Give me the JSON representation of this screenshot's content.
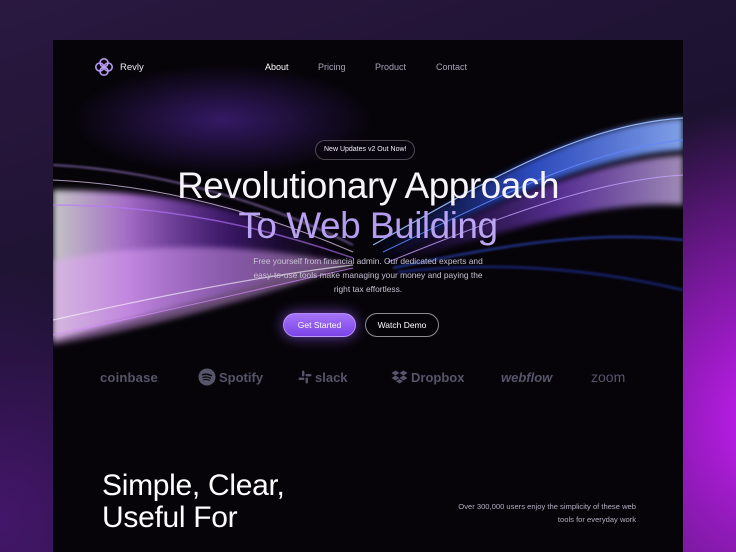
{
  "brand": {
    "name": "Revly"
  },
  "nav": {
    "items": [
      {
        "label": "About",
        "active": true
      },
      {
        "label": "Pricing",
        "active": false
      },
      {
        "label": "Product",
        "active": false
      },
      {
        "label": "Contact",
        "active": false
      }
    ]
  },
  "hero": {
    "badge": "New Updates v2 Out Now!",
    "title_line1": "Revolutionary Approach",
    "title_line2": "To Web Building",
    "subtitle": "Free yourself from financial admin. Our dedicated experts and easy-to-use tools make managing your money and paying the right tax effortless.",
    "primary_cta": "Get Started",
    "secondary_cta": "Watch Demo"
  },
  "logos": [
    "coinbase",
    "Spotify",
    "slack",
    "Dropbox",
    "webflow",
    "zoom"
  ],
  "section": {
    "title_line1": "Simple, Clear,",
    "title_line2": "Useful For",
    "note": "Over 300,000 users enjoy the simplicity of these web tools for everyday work"
  },
  "colors": {
    "accent": "#8a55ee",
    "background": "#060409",
    "glow": "#c21df0",
    "logo_gray": "#57556a"
  },
  "icons": {
    "brand": "flower-logo-icon",
    "spotify": "spotify-icon",
    "slack": "slack-icon",
    "dropbox": "dropbox-icon"
  }
}
